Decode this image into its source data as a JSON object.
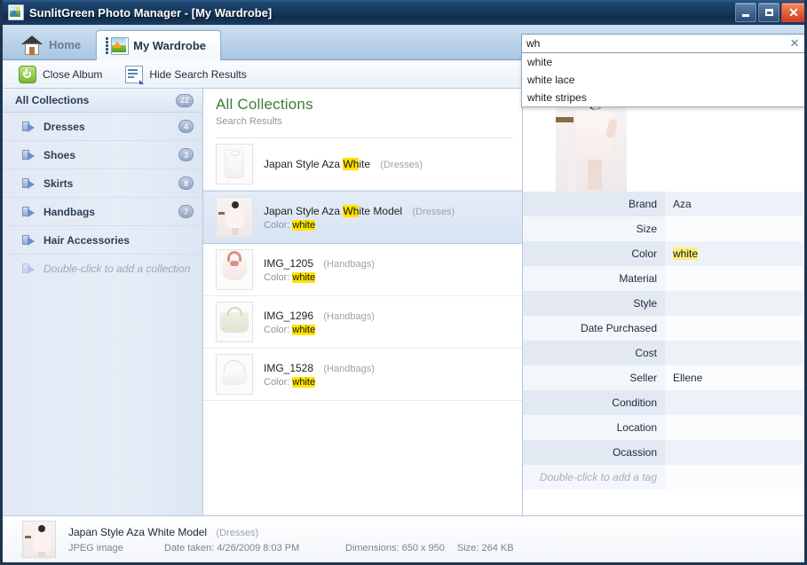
{
  "window": {
    "title": "SunlitGreen Photo Manager - [My Wardrobe]",
    "minimize_label": "",
    "maximize_label": "",
    "close_label": "✕"
  },
  "tabs": [
    {
      "label": "Home",
      "icon": "home-icon",
      "active": false
    },
    {
      "label": "My Wardrobe",
      "icon": "photo-album-icon",
      "active": true
    }
  ],
  "toolbar": {
    "close_album_label": "Close Album",
    "hide_search_results_label": "Hide Search Results"
  },
  "search": {
    "value": "wh",
    "placeholder": "",
    "clear_icon": "✕",
    "suggestions": [
      "white",
      "white lace",
      "white stripes"
    ]
  },
  "sidebar": {
    "header": {
      "label": "All Collections",
      "count": "22"
    },
    "items": [
      {
        "label": "Dresses",
        "count": "4"
      },
      {
        "label": "Shoes",
        "count": "3"
      },
      {
        "label": "Skirts",
        "count": "8"
      },
      {
        "label": "Handbags",
        "count": "7"
      },
      {
        "label": "Hair Accessories",
        "count": ""
      }
    ],
    "add_placeholder": "Double-click to add a collection"
  },
  "results": {
    "title": "All Collections",
    "subtitle": "Search Results",
    "rows": [
      {
        "name_pre": "Japan Style Aza ",
        "name_hl": "Wh",
        "name_post": "ite",
        "category": "(Dresses)",
        "detail_label": "",
        "detail_hl": "",
        "thumb": "dress-thumb",
        "selected": false
      },
      {
        "name_pre": "Japan Style Aza ",
        "name_hl": "Wh",
        "name_post": "ite Model",
        "category": "(Dresses)",
        "detail_label": "Color: ",
        "detail_hl": "white",
        "thumb": "model-thumb",
        "selected": true
      },
      {
        "name_pre": "IMG_1205",
        "name_hl": "",
        "name_post": "",
        "category": "(Handbags)",
        "detail_label": "Color: ",
        "detail_hl": "white",
        "thumb": "handbag-pink-thumb",
        "selected": false
      },
      {
        "name_pre": "IMG_1296",
        "name_hl": "",
        "name_post": "",
        "category": "(Handbags)",
        "detail_label": "Color: ",
        "detail_hl": "white",
        "thumb": "handbag-green-thumb",
        "selected": false
      },
      {
        "name_pre": "IMG_1528",
        "name_hl": "",
        "name_post": "",
        "category": "(Handbags)",
        "detail_label": "Color: ",
        "detail_hl": "white",
        "thumb": "handbag-white-thumb",
        "selected": false
      }
    ]
  },
  "detail": {
    "fields": [
      {
        "label": "Brand",
        "value": "Aza",
        "highlight": false
      },
      {
        "label": "Size",
        "value": "",
        "highlight": false
      },
      {
        "label": "Color",
        "value": "white",
        "highlight": true
      },
      {
        "label": "Material",
        "value": "",
        "highlight": false
      },
      {
        "label": "Style",
        "value": "",
        "highlight": false
      },
      {
        "label": "Date Purchased",
        "value": "",
        "highlight": false
      },
      {
        "label": "Cost",
        "value": "",
        "highlight": false
      },
      {
        "label": "Seller",
        "value": "Ellene",
        "highlight": false
      },
      {
        "label": "Condition",
        "value": "",
        "highlight": false
      },
      {
        "label": "Location",
        "value": "",
        "highlight": false
      },
      {
        "label": "Ocassion",
        "value": "",
        "highlight": false
      }
    ],
    "add_tag_placeholder": "Double-click to add a tag"
  },
  "status": {
    "name": "Japan Style Aza White Model",
    "category": "(Dresses)",
    "file_type": "JPEG image",
    "date_taken": "Date taken: 4/26/2009 8:03 PM",
    "dimensions": "Dimensions: 650 x 950",
    "size": "Size: 264 KB"
  },
  "colors": {
    "title_bar": "#163a60",
    "accent_green": "#3f7a3a",
    "highlight_yellow": "#ffe400",
    "selection_blue": "#d8e4f4"
  }
}
